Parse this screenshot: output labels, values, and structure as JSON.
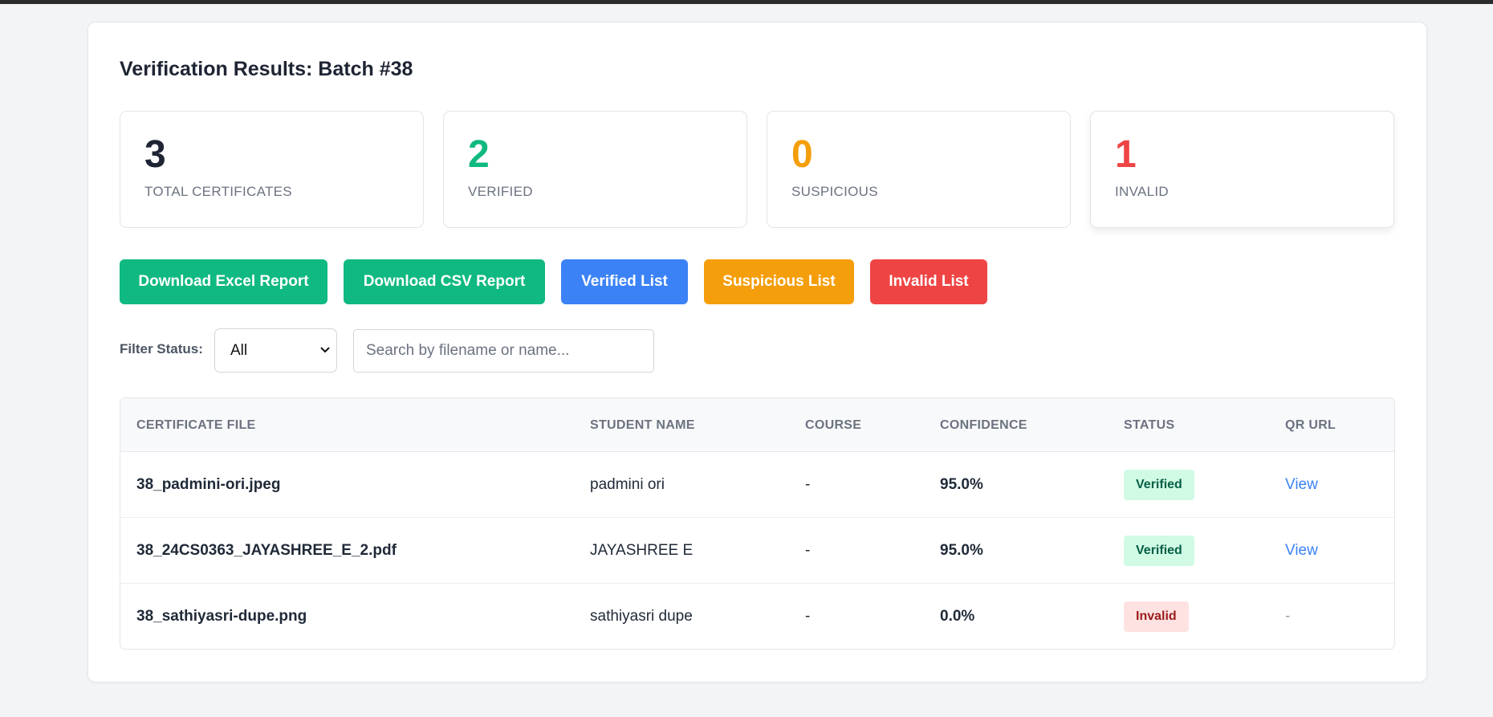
{
  "page": {
    "title": "Verification Results: Batch #38"
  },
  "stats": [
    {
      "value": "3",
      "label": "TOTAL CERTIFICATES",
      "color": "#1e2433"
    },
    {
      "value": "2",
      "label": "VERIFIED",
      "color": "#10b981"
    },
    {
      "value": "0",
      "label": "SUSPICIOUS",
      "color": "#f59e0b"
    },
    {
      "value": "1",
      "label": "INVALID",
      "color": "#ef4444"
    }
  ],
  "actions": [
    {
      "label": "Download Excel Report",
      "color": "#10b981"
    },
    {
      "label": "Download CSV Report",
      "color": "#10b981"
    },
    {
      "label": "Verified List",
      "color": "#3b82f6"
    },
    {
      "label": "Suspicious List",
      "color": "#f59e0b"
    },
    {
      "label": "Invalid List",
      "color": "#ef4444"
    }
  ],
  "filter": {
    "label": "Filter Status:",
    "selected": "All",
    "search_placeholder": "Search by filename or name..."
  },
  "table": {
    "columns": [
      "CERTIFICATE FILE",
      "STUDENT NAME",
      "COURSE",
      "CONFIDENCE",
      "STATUS",
      "QR URL"
    ],
    "rows": [
      {
        "file": "38_padmini-ori.jpeg",
        "student": "padmini ori",
        "course": "-",
        "confidence": "95.0%",
        "status": "Verified",
        "qr": "View"
      },
      {
        "file": "38_24CS0363_JAYASHREE_E_2.pdf",
        "student": "JAYASHREE E",
        "course": "-",
        "confidence": "95.0%",
        "status": "Verified",
        "qr": "View"
      },
      {
        "file": "38_sathiyasri-dupe.png",
        "student": "sathiyasri dupe",
        "course": "-",
        "confidence": "0.0%",
        "status": "Invalid",
        "qr": "-"
      }
    ]
  },
  "status_styles": {
    "Verified": {
      "bg": "#d1fae5",
      "fg": "#065f46"
    },
    "Invalid": {
      "bg": "#fee2e2",
      "fg": "#991b1b"
    }
  }
}
